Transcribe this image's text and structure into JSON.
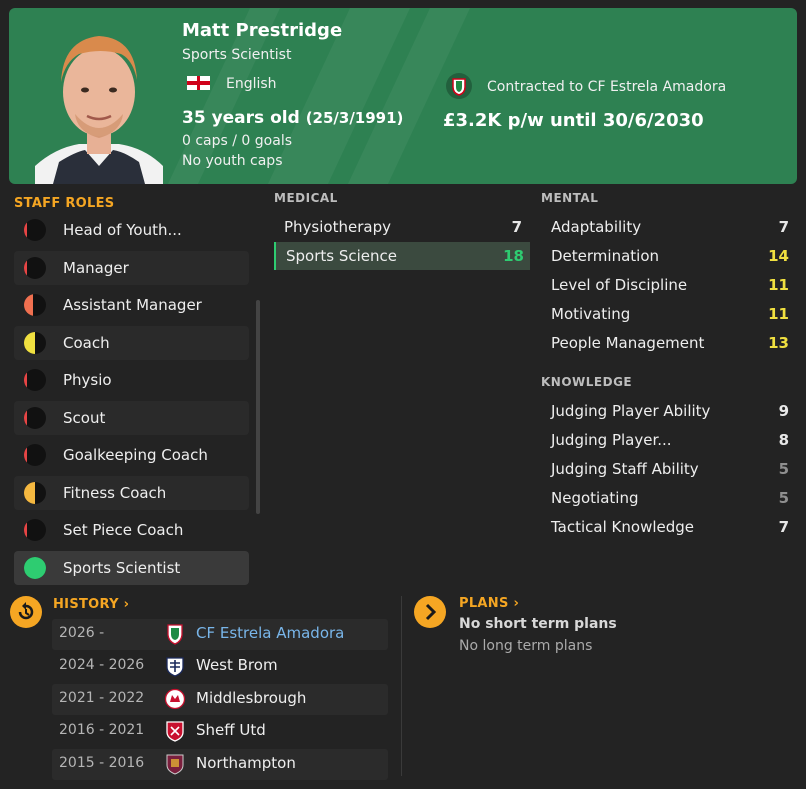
{
  "profile": {
    "name": "Matt Prestridge",
    "job": "Sports Scientist",
    "nationality": "English",
    "age": "35 years old",
    "dob": "(25/3/1991)",
    "caps": "0 caps / 0 goals",
    "youth_caps": "No youth caps",
    "contract": "Contracted to CF Estrela Amadora",
    "wage": "£3.2K p/w until 30/6/2030",
    "icons": [
      "portrait-photo",
      "england-flag",
      "estrela-amadora-badge"
    ]
  },
  "staff_roles": {
    "title": "STAFF ROLES",
    "items": [
      {
        "label": "Head of Youth...",
        "suitability": 0.15,
        "color": "#e64545"
      },
      {
        "label": "Manager",
        "suitability": 0.15,
        "color": "#e64545"
      },
      {
        "label": "Assistant Manager",
        "suitability": 0.4,
        "color": "#f07050"
      },
      {
        "label": "Coach",
        "suitability": 0.5,
        "color": "#f0e040"
      },
      {
        "label": "Physio",
        "suitability": 0.15,
        "color": "#e64545"
      },
      {
        "label": "Scout",
        "suitability": 0.15,
        "color": "#e64545"
      },
      {
        "label": "Goalkeeping Coach",
        "suitability": 0.15,
        "color": "#e64545"
      },
      {
        "label": "Fitness Coach",
        "suitability": 0.5,
        "color": "#f5b840"
      },
      {
        "label": "Set Piece Coach",
        "suitability": 0.15,
        "color": "#e64545"
      },
      {
        "label": "Sports Scientist",
        "suitability": 1.0,
        "color": "#2ecc71"
      }
    ]
  },
  "attributes": {
    "medical": {
      "title": "MEDICAL",
      "items": [
        {
          "name": "Physiotherapy",
          "value": "7",
          "color": "#e8e8e8"
        },
        {
          "name": "Sports Science",
          "value": "18",
          "color": "#2ecc71"
        }
      ]
    },
    "mental": {
      "title": "MENTAL",
      "items": [
        {
          "name": "Adaptability",
          "value": "7",
          "color": "#e8e8e8"
        },
        {
          "name": "Determination",
          "value": "14",
          "color": "#f0e040"
        },
        {
          "name": "Level of Discipline",
          "value": "11",
          "color": "#f0e040"
        },
        {
          "name": "Motivating",
          "value": "11",
          "color": "#f0e040"
        },
        {
          "name": "People Management",
          "value": "13",
          "color": "#f0e040"
        }
      ]
    },
    "knowledge": {
      "title": "KNOWLEDGE",
      "items": [
        {
          "name": "Judging Player Ability",
          "value": "9",
          "color": "#e8e8e8"
        },
        {
          "name": "Judging Player...",
          "value": "8",
          "color": "#e8e8e8"
        },
        {
          "name": "Judging Staff Ability",
          "value": "5",
          "color": "#8f8f8f"
        },
        {
          "name": "Negotiating",
          "value": "5",
          "color": "#8f8f8f"
        },
        {
          "name": "Tactical Knowledge",
          "value": "7",
          "color": "#e8e8e8"
        }
      ]
    }
  },
  "history": {
    "title": "HISTORY",
    "rows": [
      {
        "years": "2026 -",
        "club": "CF Estrela Amadora",
        "badge": "estrela-amadora-badge"
      },
      {
        "years": "2024 - 2026",
        "club": "West Brom",
        "badge": "west-brom-badge"
      },
      {
        "years": "2021 - 2022",
        "club": "Middlesbrough",
        "badge": "middlesbrough-badge"
      },
      {
        "years": "2016 - 2021",
        "club": "Sheff Utd",
        "badge": "sheff-utd-badge"
      },
      {
        "years": "2015 - 2016",
        "club": "Northampton",
        "badge": "northampton-badge"
      }
    ]
  },
  "plans": {
    "title": "PLANS",
    "short": "No short term plans",
    "long": "No long term plans"
  },
  "colors": {
    "header_bg": "#2e8152",
    "accent": "#f5a623",
    "good": "#2ecc71"
  }
}
